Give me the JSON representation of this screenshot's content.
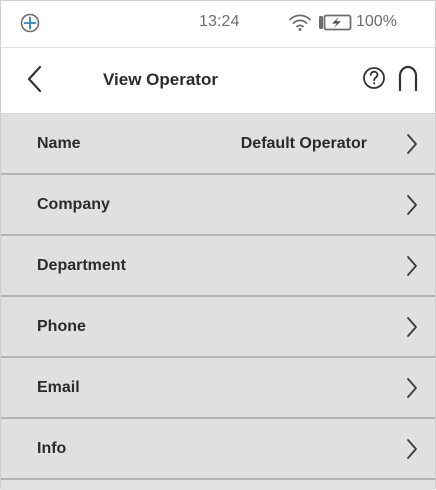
{
  "status_bar": {
    "left_icon": "globe-plus-icon",
    "time": "13:24",
    "wifi_icon": "wifi-icon",
    "battery_icon": "battery-charging-icon",
    "battery_percent": "100%"
  },
  "header": {
    "back_icon": "chevron-left-icon",
    "title": "View Operator",
    "help_icon": "help-circle-icon",
    "home_icon": "home-arch-icon"
  },
  "list": {
    "items": [
      {
        "label": "Name",
        "value": "Default Operator"
      },
      {
        "label": "Company",
        "value": ""
      },
      {
        "label": "Department",
        "value": ""
      },
      {
        "label": "Phone",
        "value": ""
      },
      {
        "label": "Email",
        "value": ""
      },
      {
        "label": "Info",
        "value": ""
      }
    ],
    "chevron_icon": "chevron-right-icon"
  },
  "colors": {
    "list_background": "#e0e0e0",
    "divider": "#b4b4b4",
    "text": "#2b2b2b",
    "status_text": "#6d6d6d"
  }
}
